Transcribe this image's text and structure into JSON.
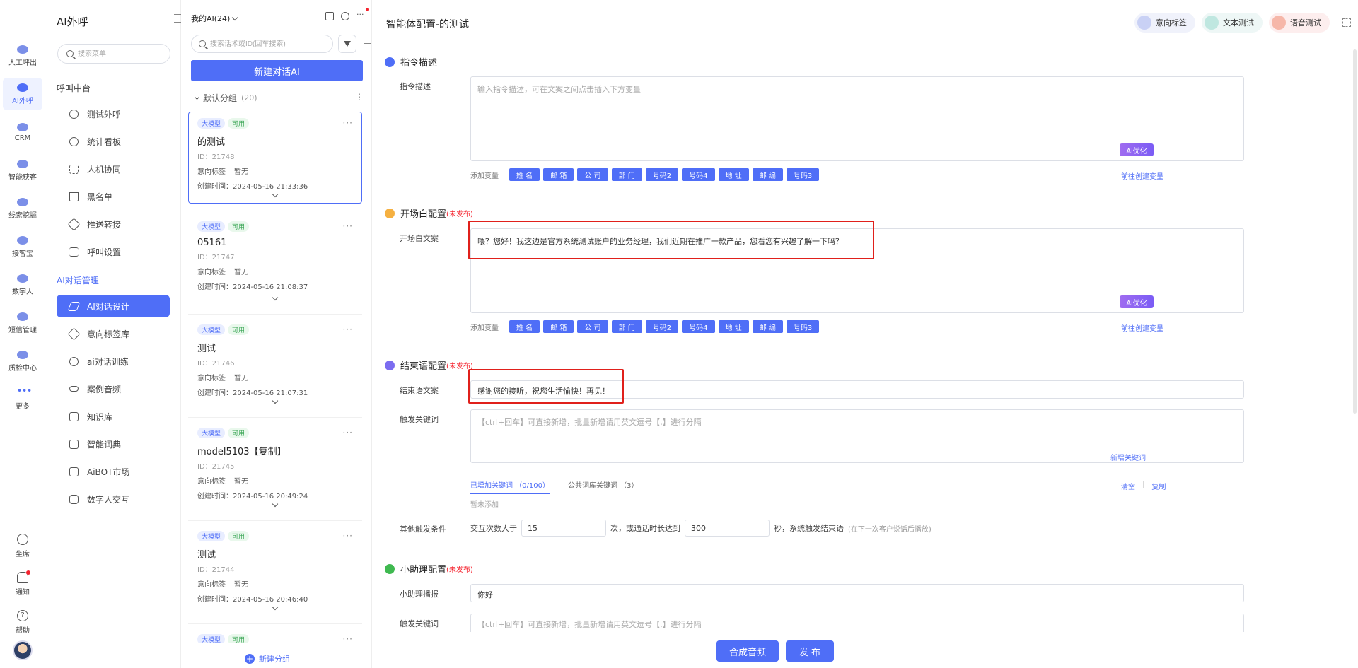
{
  "rail": {
    "items": [
      {
        "label": "人工坪出"
      },
      {
        "label": "AI外呼"
      },
      {
        "label": "CRM"
      },
      {
        "label": "智能获客"
      },
      {
        "label": "线索挖掘"
      },
      {
        "label": "接客宝"
      },
      {
        "label": "数字人"
      },
      {
        "label": "短信管理"
      },
      {
        "label": "质检中心"
      },
      {
        "label": "更多"
      }
    ],
    "bottom": [
      {
        "label": "坐席"
      },
      {
        "label": "通知"
      },
      {
        "label": "帮助"
      }
    ]
  },
  "nav": {
    "title": "AI外呼",
    "search_placeholder": "搜索菜单",
    "section1": "呼叫中台",
    "items1": [
      {
        "label": "测试外呼"
      },
      {
        "label": "统计看板"
      },
      {
        "label": "人机协同"
      },
      {
        "label": "黑名单"
      },
      {
        "label": "推送转接"
      },
      {
        "label": "呼叫设置"
      }
    ],
    "section2": "AI对话管理",
    "items2": [
      {
        "label": "AI对话设计"
      },
      {
        "label": "意向标签库"
      },
      {
        "label": "ai对话训练"
      },
      {
        "label": "案例音频"
      },
      {
        "label": "知识库"
      },
      {
        "label": "智能词典"
      },
      {
        "label": "AiBOT市场"
      },
      {
        "label": "数字人交互"
      }
    ]
  },
  "list": {
    "header": "我的AI(24)",
    "search_placeholder": "搜索话术或ID(回车搜索)",
    "new_button": "新建对话AI",
    "group_name": "默认分组",
    "group_count": "(20)",
    "new_group": "新建分组",
    "tag_model": "大模型",
    "tag_ok": "可用",
    "intent_label": "意向标签",
    "intent_value": "暂无",
    "cards": [
      {
        "name": "的测试",
        "id": "ID：21748",
        "time": "创建时间：2024-05-16 21:33:36"
      },
      {
        "name": "05161",
        "id": "ID：21747",
        "time": "创建时间：2024-05-16 21:08:37"
      },
      {
        "name": "测试",
        "id": "ID：21746",
        "time": "创建时间：2024-05-16 21:07:31"
      },
      {
        "name": "model5103【复制】",
        "id": "ID：21745",
        "time": "创建时间：2024-05-16 20:49:24"
      },
      {
        "name": "测试",
        "id": "ID：21744",
        "time": "创建时间：2024-05-16 20:46:40"
      },
      {
        "name": "",
        "id": "",
        "time": ""
      }
    ]
  },
  "main": {
    "title": "智能体配置-的测试",
    "top_buttons": {
      "intent": "意向标签",
      "text_test": "文本测试",
      "voice_test": "语音测试"
    },
    "instruction": {
      "title": "指令描述",
      "label": "指令描述",
      "placeholder": "输入指令描述，可在文案之间点击插入下方变量",
      "ai": "Ai优化"
    },
    "vars_label": "添加变量",
    "vars": [
      "姓 名",
      "邮 箱",
      "公 司",
      "部 门",
      "号码2",
      "号码4",
      "地 址",
      "邮 编",
      "号码3"
    ],
    "create_var_link": "前往创建变量",
    "unpublished": "(未发布)",
    "opening": {
      "title": "开场白配置",
      "label": "开场白文案",
      "text": "喂？您好！我这边是官方系统测试账户的业务经理，我们近期在推广一款产品，您看您有兴趣了解一下吗？",
      "ai": "Ai优化"
    },
    "ending": {
      "title": "结束语配置",
      "label": "结束语文案",
      "text": "感谢您的接听，祝您生活愉快！再见！",
      "kw_label": "触发关键词",
      "kw_placeholder": "【ctrl+回车】可直接新增，批量新增请用英文逗号【,】进行分隔",
      "kw_add": "新增关键词",
      "tab_added": "已增加关键词 （0/100）",
      "tab_public": "公共词库关键词 （3）",
      "clear": "清空",
      "copy": "复制",
      "empty": "暂未添加",
      "cond_label": "其他触发条件",
      "cond_a": "交互次数大于",
      "cond_a_val": "15",
      "cond_b": "次，或通话时长达到",
      "cond_b_val": "300",
      "cond_c": "秒，系统触发结束语",
      "cond_hint": "(在下一次客户说话后播放)"
    },
    "assistant": {
      "title": "小助理配置",
      "label": "小助理播报",
      "text": "你好",
      "kw_label": "触发关键词",
      "kw_placeholder": "【ctrl+回车】可直接新增，批量新增请用英文逗号【,】进行分隔"
    },
    "btn_synth": "合成音频",
    "btn_publish": "发 布"
  },
  "colors": {
    "accent": "#4f6ef7",
    "red": "#e0201b"
  }
}
